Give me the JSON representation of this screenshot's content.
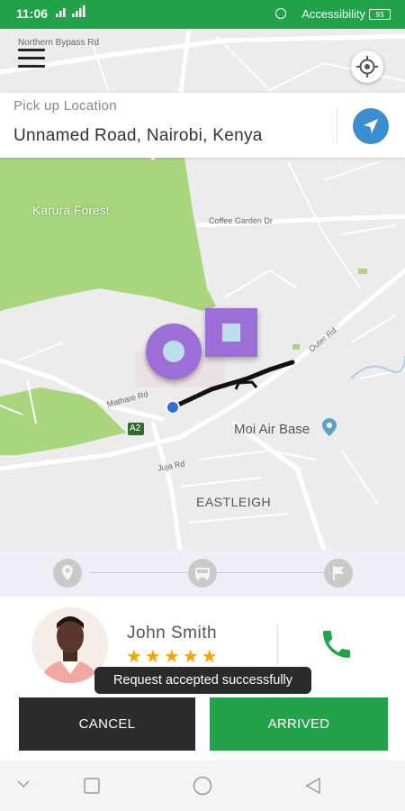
{
  "status_bar": {
    "time": "11:06",
    "signal": "ᵀᴱᴸ▐▌▐▌",
    "accessibility": "Accessibility",
    "battery": "93"
  },
  "map": {
    "labels": {
      "northern_bypass": "Northern Bypass Rd",
      "karura_forest": "Karura Forest",
      "coffee_garden": "Coffee Garden Dr",
      "moi_air_base": "Moi Air Base",
      "eastleigh": "EASTLEIGH",
      "a2": "A2",
      "mathare": "Mathare Rd",
      "juja": "Juja Rd",
      "outer": "Outer Rd"
    }
  },
  "pickup": {
    "label": "Pick up Location",
    "value": "Unnamed Road, Nairobi, Kenya"
  },
  "driver": {
    "name": "John Smith",
    "rating": 5,
    "stars": "★★★★★"
  },
  "toast": "Request accepted successfully",
  "buttons": {
    "cancel": "CANCEL",
    "arrived": "ARRIVED"
  },
  "colors": {
    "primary": "#22a34a",
    "dark": "#2b2b2b",
    "route_purple": "#9b6fd6",
    "nav_blue": "#3b8dd0",
    "star": "#f4a30b"
  },
  "icons": {
    "menu": "hamburger-menu-icon",
    "gps": "locate-icon",
    "navigate": "navigation-arrow-icon",
    "step1": "location-pin-icon",
    "step2": "bus-icon",
    "step3": "flag-icon",
    "phone": "phone-icon"
  }
}
